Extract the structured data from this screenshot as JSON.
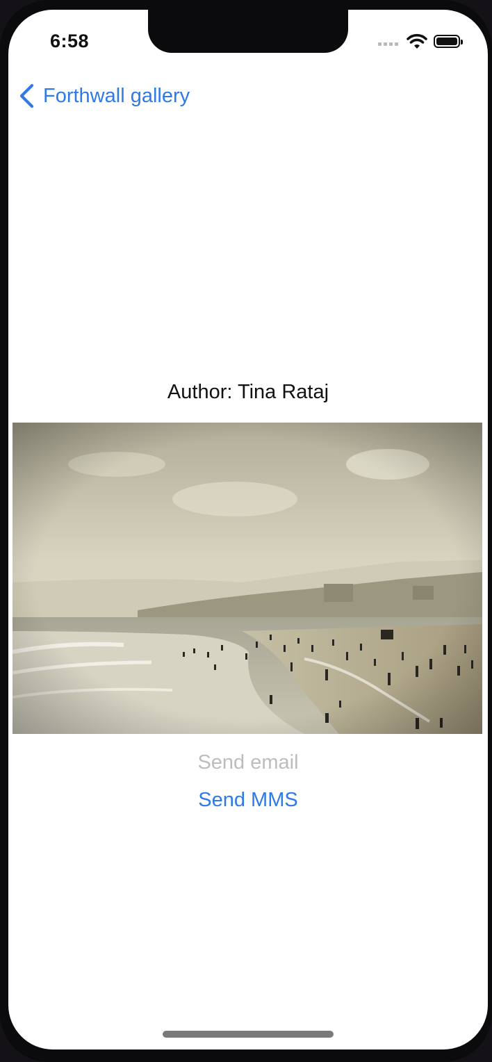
{
  "status_bar": {
    "time": "6:58"
  },
  "nav": {
    "back_label": "Forthwall gallery"
  },
  "detail": {
    "author_text": "Author: Tina Rataj",
    "send_email_label": "Send email",
    "send_mms_label": "Send MMS"
  },
  "colors": {
    "accent": "#2f7ae5",
    "disabled": "#bdbdbd"
  },
  "icons": [
    "chevron-left-icon",
    "wifi-icon",
    "battery-icon",
    "cellular-signal-icon"
  ]
}
